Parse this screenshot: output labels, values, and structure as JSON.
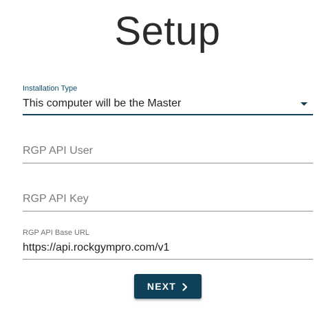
{
  "title": "Setup",
  "form": {
    "installation_type": {
      "label": "Installation Type",
      "selected": "This computer will be the Master"
    },
    "api_user": {
      "placeholder": "RGP API User",
      "value": ""
    },
    "api_key": {
      "placeholder": "RGP API Key",
      "value": ""
    },
    "api_base_url": {
      "label": "RGP API Base URL",
      "value": "https://api.rockgympro.com/v1"
    }
  },
  "next_button": {
    "label": "NEXT",
    "icon": "chevron-right-icon"
  },
  "colors": {
    "accent": "#0e4159",
    "focused_label": "#0e4e6b",
    "underline": "#8f8f8f"
  }
}
